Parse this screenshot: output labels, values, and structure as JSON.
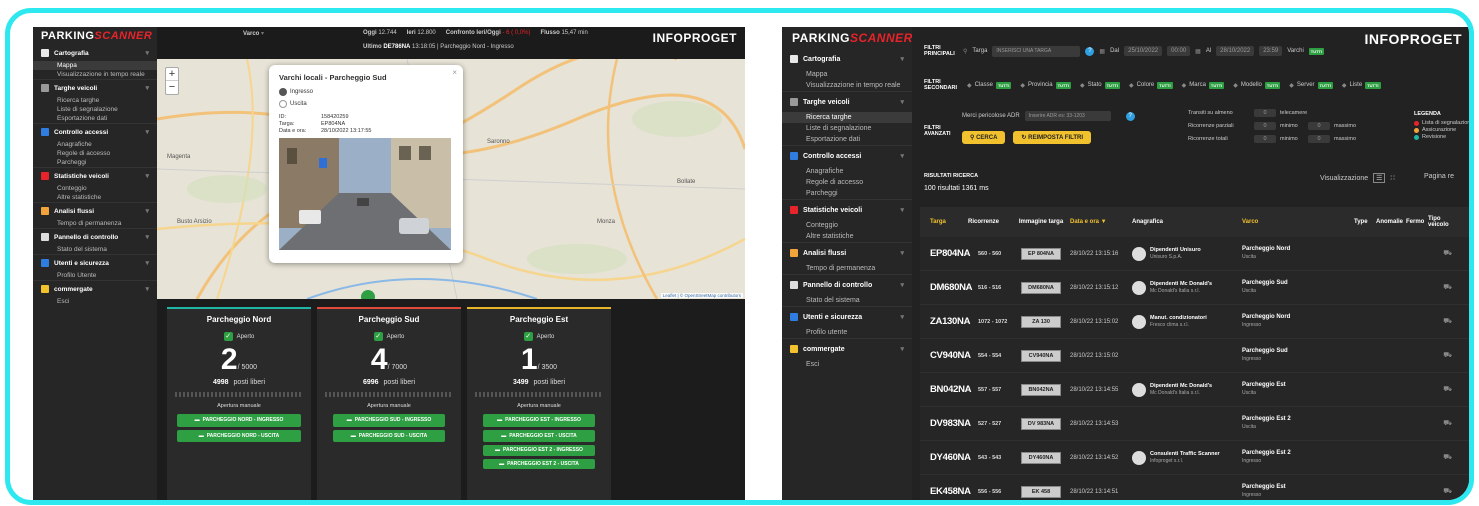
{
  "left": {
    "brand": "PARKING",
    "brand_accent": "SCANNER",
    "logo": "INFOPROGET",
    "topbar": {
      "varco_label": "Varco",
      "oggi_label": "Oggi",
      "oggi_value": "12.744",
      "ieri_label": "Ieri",
      "ieri_value": "12.800",
      "confronto_label": "Confronto Ieri/Oggi",
      "confronto_value": "- 6 ( 0,0%)",
      "flusso_label": "Flusso",
      "flusso_value": "15,47 min",
      "ultimo_label": "Ultimo",
      "ultimo_plate": "DE786NA",
      "ultimo_info": "13:18:05 | Parcheggio Nord - Ingresso"
    },
    "sidebar": [
      {
        "label": "Cartografia",
        "icon": "map-icon",
        "color": "#e8e8e8",
        "subs": [
          "Mappa",
          "Visualizzazione in tempo reale"
        ],
        "sel": 0
      },
      {
        "label": "Targhe veicoli",
        "icon": "search-icon",
        "color": "#999999",
        "subs": [
          "Ricerca targhe",
          "Liste di segnalazione",
          "Esportazione dati"
        ],
        "sel": -1
      },
      {
        "label": "Controllo accessi",
        "icon": "parking-icon",
        "color": "#2f7de1",
        "subs": [
          "Anagrafiche",
          "Regole di accesso",
          "Parcheggi"
        ],
        "sel": -1
      },
      {
        "label": "Statistiche veicoli",
        "icon": "chart-icon",
        "color": "#e8232a",
        "subs": [
          "Conteggio",
          "Altre statistiche"
        ],
        "sel": -1
      },
      {
        "label": "Analisi flussi",
        "icon": "flow-icon",
        "color": "#f2a33a",
        "subs": [
          "Tempo di permanenza"
        ],
        "sel": -1
      },
      {
        "label": "Pannello di controllo",
        "icon": "gear-icon",
        "color": "#dddddd",
        "subs": [
          "Stato del sistema"
        ],
        "sel": -1
      },
      {
        "label": "Utenti e sicurezza",
        "icon": "users-icon",
        "color": "#2f7de1",
        "subs": [
          "Profilo Utente"
        ],
        "sel": -1
      },
      {
        "label": "commergate",
        "icon": "key-icon",
        "color": "#f2c12e",
        "subs": [
          "Esci"
        ],
        "sel": -1
      }
    ],
    "map": {
      "attribution": "Leaflet | © OpenStreetMap contributors",
      "places": [
        "Monza",
        "Busto Arsizio",
        "Saronno",
        "Magenta",
        "Bollate"
      ],
      "popup": {
        "title": "Varchi locali - Parcheggio Sud",
        "opt1": "Ingresso",
        "opt2": "Uscita",
        "id_label": "ID:",
        "id_value": "158420259",
        "plate_label": "Targa:",
        "plate_value": "EP804NA",
        "date_label": "Data e ora:",
        "date_value": "28/10/2022 13:17:55"
      }
    },
    "parkings": [
      {
        "name": "Parcheggio Nord",
        "color": "#1fb6a6",
        "status": "Aperto",
        "count": "2",
        "total": "/ 5000",
        "free": "4998",
        "free_label": "posti liberi",
        "manual": "Apertura manuale",
        "buttons": [
          "PARCHEGGIO NORD - INGRESSO",
          "PARCHEGGIO NORD - USCITA"
        ]
      },
      {
        "name": "Parcheggio Sud",
        "color": "#e04a3a",
        "status": "Aperto",
        "count": "4",
        "total": "/ 7000",
        "free": "6996",
        "free_label": "posti liberi",
        "manual": "Apertura manuale",
        "buttons": [
          "PARCHEGGIO SUD - INGRESSO",
          "PARCHEGGIO SUD - USCITA"
        ]
      },
      {
        "name": "Parcheggio Est",
        "color": "#e6b52a",
        "status": "Aperto",
        "count": "1",
        "total": "/ 3500",
        "free": "3499",
        "free_label": "posti liberi",
        "manual": "Apertura manuale",
        "buttons": [
          "PARCHEGGIO EST - INGRESSO",
          "PARCHEGGIO EST - USCITA",
          "PARCHEGGIO EST 2 - INGRESSO",
          "PARCHEGGIO EST 2 - USCITA"
        ]
      }
    ]
  },
  "right": {
    "brand": "PARKING",
    "brand_accent": "SCANNER",
    "logo": "INFOPROGET",
    "sidebar": [
      {
        "label": "Cartografia",
        "icon": "map-icon",
        "color": "#e8e8e8",
        "subs": [
          "Mappa",
          "Visualizzazione in tempo reale"
        ],
        "sel": -1
      },
      {
        "label": "Targhe veicoli",
        "icon": "search-icon",
        "color": "#999999",
        "subs": [
          "Ricerca targhe",
          "Liste di segnalazione",
          "Esportazione dati"
        ],
        "sel": 0
      },
      {
        "label": "Controllo accessi",
        "icon": "parking-icon",
        "color": "#2f7de1",
        "subs": [
          "Anagrafiche",
          "Regole di accesso",
          "Parcheggi"
        ],
        "sel": -1
      },
      {
        "label": "Statistiche veicoli",
        "icon": "chart-icon",
        "color": "#e8232a",
        "subs": [
          "Conteggio",
          "Altre statistiche"
        ],
        "sel": -1
      },
      {
        "label": "Analisi flussi",
        "icon": "flow-icon",
        "color": "#f2a33a",
        "subs": [
          "Tempo di permanenza"
        ],
        "sel": -1
      },
      {
        "label": "Pannello di controllo",
        "icon": "gear-icon",
        "color": "#dddddd",
        "subs": [
          "Stato del sistema"
        ],
        "sel": -1
      },
      {
        "label": "Utenti e sicurezza",
        "icon": "users-icon",
        "color": "#2f7de1",
        "subs": [
          "Profilo utente"
        ],
        "sel": -1
      },
      {
        "label": "commergate",
        "icon": "key-icon",
        "color": "#f2c12e",
        "subs": [
          "Esci"
        ],
        "sel": -1
      }
    ],
    "filters": {
      "main_label": "FILTRI PRINCIPALI",
      "targa_label": "Targa",
      "targa_placeholder": "INSERISCI UNA TARGA",
      "dal_label": "Dal",
      "dal_date": "25/10/2022",
      "dal_time": "00:00",
      "al_label": "Al",
      "al_date": "28/10/2022",
      "al_time": "23:59",
      "varchi_label": "Varchi",
      "tag": "TUTTI",
      "sec_label": "FILTRI SECONDARI",
      "sec_items": [
        "Classe",
        "Provincia",
        "Stato",
        "Colore",
        "Marca",
        "Modello",
        "Server",
        "Liste"
      ],
      "adv_label": "FILTRI AVANZATI",
      "merci_label": "Merci pericolose ADR",
      "merci_placeholder": "Inserire ADR es: 33-1203",
      "search_btn": "CERCA",
      "reset_btn": "REIMPOSTA FILTRI",
      "transit_label": "Transiti su almeno",
      "transit_value": "0",
      "transit_unit": "telecamere",
      "partial_label": "Ricorrenze parziali",
      "partial_min": "0",
      "partial_max": "0",
      "total_label": "Ricorrenze totali",
      "total_min": "0",
      "total_max": "0",
      "min_word": "minimo",
      "max_word": "massimo",
      "legend_title": "LEGENDA",
      "legend": [
        {
          "label": "Lista di segnalazione",
          "color": "#e8232a"
        },
        {
          "label": "Assicurazione",
          "color": "#f2a33a"
        },
        {
          "label": "Revisione",
          "color": "#1fb6a6"
        }
      ]
    },
    "results": {
      "title": "RISULTATI RICERCA",
      "summary": "100 risultati 1361 ms",
      "view_label": "Visualizzazione",
      "page_label": "Pagina re",
      "columns": [
        "Targa",
        "Ricorrenze",
        "Immagine targa",
        "Data e ora",
        "Anagrafica",
        "Varco",
        "Type",
        "Anomalie",
        "Fermo",
        "Tipo veicolo"
      ],
      "rows": [
        {
          "plate": "EP804NA",
          "rec": "560 - 560",
          "img": "EP 804NA",
          "date": "28/10/22 13:15:16",
          "name": "Dipendenti Unisuro",
          "company": "Unisuro S.p.A.",
          "varco": "Parcheggio Nord",
          "dir": "Uscita"
        },
        {
          "plate": "DM680NA",
          "rec": "516 - 516",
          "img": "DM680NA",
          "date": "28/10/22 13:15:12",
          "name": "Dipendenti Mc Donald's",
          "company": "Mc Donald's Italia s.r.l.",
          "varco": "Parcheggio Sud",
          "dir": "Uscita"
        },
        {
          "plate": "ZA130NA",
          "rec": "1072 - 1072",
          "img": "ZA 130",
          "date": "28/10/22 13:15:02",
          "name": "Manut. condizionatori",
          "company": "Fresco clima s.r.l.",
          "varco": "Parcheggio Nord",
          "dir": "Ingresso"
        },
        {
          "plate": "CV940NA",
          "rec": "554 - 554",
          "img": "CV940NA",
          "date": "28/10/22 13:15:02",
          "name": "",
          "company": "",
          "varco": "Parcheggio Sud",
          "dir": "Ingresso"
        },
        {
          "plate": "BN042NA",
          "rec": "557 - 557",
          "img": "BN042NA",
          "date": "28/10/22 13:14:55",
          "name": "Dipendenti Mc Donald's",
          "company": "Mc Donald's Italia s.r.l.",
          "varco": "Parcheggio Est",
          "dir": "Uscita"
        },
        {
          "plate": "DV983NA",
          "rec": "527 - 527",
          "img": "DV 983NA",
          "date": "28/10/22 13:14:53",
          "name": "",
          "company": "",
          "varco": "Parcheggio Est 2",
          "dir": "Uscita"
        },
        {
          "plate": "DY460NA",
          "rec": "543 - 543",
          "img": "DY460NA",
          "date": "28/10/22 13:14:52",
          "name": "Consulenti Traffic Scanner",
          "company": "Infoproget s.r.l.",
          "varco": "Parcheggio Est 2",
          "dir": "Ingresso"
        },
        {
          "plate": "EK458NA",
          "rec": "556 - 556",
          "img": "EK 458",
          "date": "28/10/22 13:14:51",
          "name": "",
          "company": "",
          "varco": "Parcheggio Est",
          "dir": "Ingresso"
        }
      ]
    }
  }
}
